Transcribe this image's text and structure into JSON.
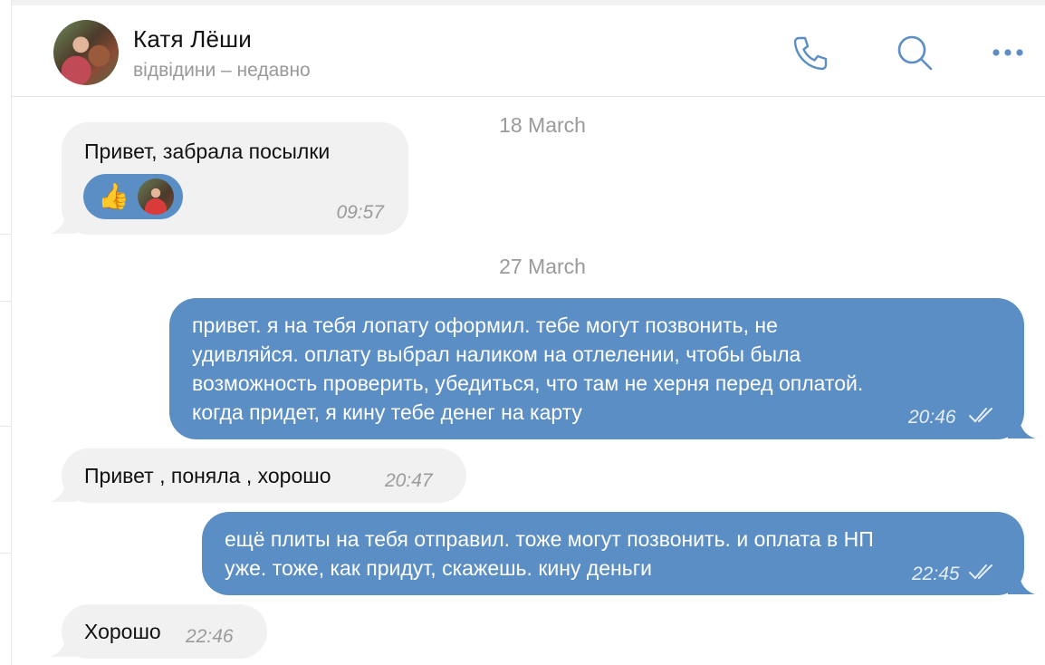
{
  "header": {
    "name": "Катя Лёши",
    "status": "відвідини – недавно",
    "icons": [
      "phone-icon",
      "search-icon",
      "more-icon"
    ]
  },
  "dates": [
    "18 March",
    "27 March"
  ],
  "messages": [
    {
      "direction": "in",
      "text": "Привет, забрала посылки",
      "time": "09:57",
      "reaction": "👍"
    },
    {
      "direction": "out",
      "lines": [
        "привет. я на тебя лопату оформил. тебе могут позвонить, не",
        "удивляйся. оплату выбрал наликом на отлелении, чтобы была",
        "возможность проверить, убедиться, что там не херня перед оплатой.",
        "когда придет, я кину тебе денег на карту"
      ],
      "time": "20:46",
      "read": true
    },
    {
      "direction": "in",
      "text": "Привет , поняла , хорошо",
      "time": "20:47"
    },
    {
      "direction": "out",
      "lines": [
        "ещё плиты на тебя отправил. тоже могут позвонить. и оплата в НП",
        "уже. тоже, как придут, скажешь. кину деньги"
      ],
      "time": "22:45",
      "read": true
    },
    {
      "direction": "in",
      "text": "Хорошо",
      "time": "22:46"
    }
  ],
  "colors": {
    "accent": "#5b8ec4",
    "incoming_bubble": "#f1f1f1",
    "muted_text": "#9a9a9a"
  }
}
